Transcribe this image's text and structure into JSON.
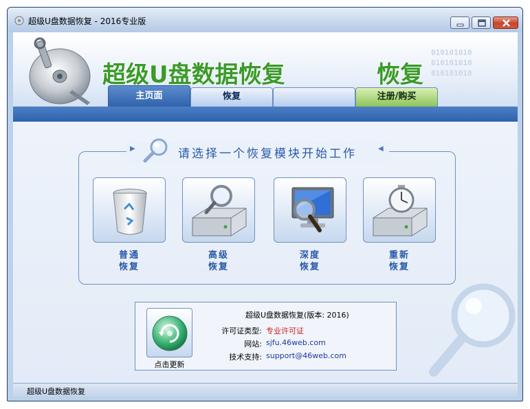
{
  "window": {
    "title": "超级U盘数据恢复 - 2016专业版",
    "controls": {
      "minimize": "minimize-icon",
      "maximize": "maximize-icon",
      "close": "close-icon"
    }
  },
  "banner": {
    "brand_title": "超级U盘数据恢复",
    "brand_fragment": "恢复",
    "binary_pattern": [
      "010101010",
      "010101010",
      "010101010"
    ],
    "logo_icon": "disk-with-wrench-icon"
  },
  "tabs": [
    {
      "label": "主页面",
      "active": true
    },
    {
      "label": "恢复",
      "active": false
    },
    {
      "label": "",
      "active": false
    },
    {
      "label": "注册/购买",
      "active": false
    }
  ],
  "main": {
    "prompt": "请选择一个恢复模块开始工作",
    "modules": [
      {
        "line1": "普通",
        "line2": "恢复",
        "icon": "recycle-bin-icon"
      },
      {
        "line1": "高级",
        "line2": "恢复",
        "icon": "drive-magnifier-icon"
      },
      {
        "line1": "深度",
        "line2": "恢复",
        "icon": "monitor-magnifier-icon"
      },
      {
        "line1": "重新",
        "line2": "恢复",
        "icon": "drive-stopwatch-icon"
      }
    ]
  },
  "info": {
    "title": "超级U盘数据恢复(版本: 2016)",
    "update_label": "点击更新",
    "rows": [
      {
        "key": "许可证类型:",
        "value": "专业许可证"
      },
      {
        "key": "网站:",
        "value": "sjfu.46web.com"
      },
      {
        "key": "技术支持:",
        "value": "support@46web.com"
      }
    ]
  },
  "status": {
    "text": "超级U盘数据恢复"
  },
  "colors": {
    "accent_blue": "#2f63ad",
    "brand_green": "#3a9a2a",
    "license_red": "#cc1c1c",
    "link_blue": "#1a38a0"
  }
}
